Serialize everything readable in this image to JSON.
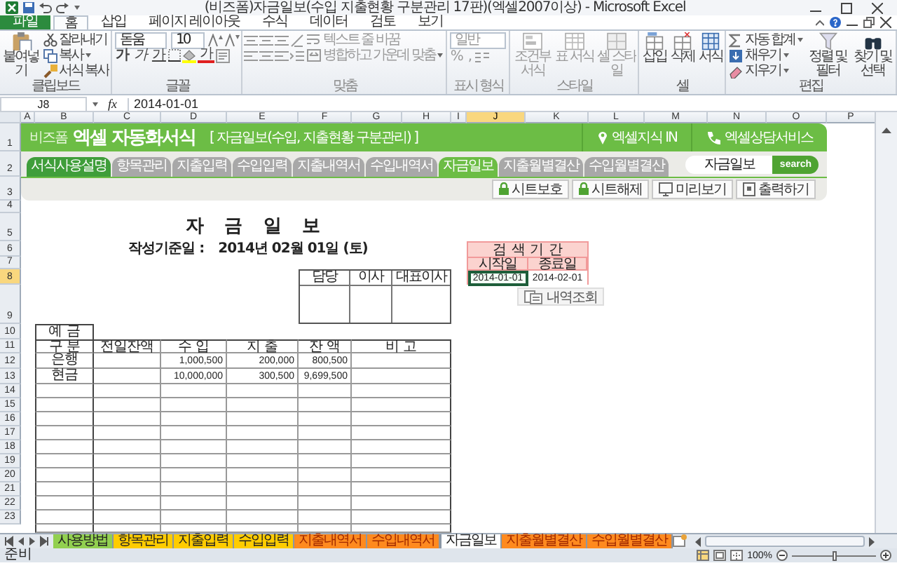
{
  "title_bar": {
    "title": "(비즈폼)자금일보(수입 지출현황 구분관리 17판)(엑셀2007이상) - Microsoft Excel"
  },
  "ribbon_tabs": [
    {
      "label": "파일",
      "kind": "file",
      "selected": false
    },
    {
      "label": "홈",
      "kind": "tab",
      "selected": true
    },
    {
      "label": "삽입",
      "kind": "tab",
      "selected": false
    },
    {
      "label": "페이지 레이아웃",
      "kind": "tab",
      "selected": false
    },
    {
      "label": "수식",
      "kind": "tab",
      "selected": false
    },
    {
      "label": "데이터",
      "kind": "tab",
      "selected": false
    },
    {
      "label": "검토",
      "kind": "tab",
      "selected": false
    },
    {
      "label": "보기",
      "kind": "tab",
      "selected": false
    }
  ],
  "ribbon_groups": [
    {
      "label": "클립보드",
      "kind": "clipboard",
      "disabled": false,
      "items": [
        "붙여넣기",
        "잘라내기",
        "복사",
        "서식 복사"
      ]
    },
    {
      "label": "글꼴",
      "kind": "font",
      "disabled": false,
      "font_name": "돋움",
      "font_size": "10",
      "items": [
        "가",
        "가",
        "가",
        "가"
      ]
    },
    {
      "label": "맞춤",
      "kind": "alignment",
      "disabled": true,
      "items": [
        "텍스트 줄 바꿈",
        "병합하고 가운데 맞춤"
      ]
    },
    {
      "label": "표시 형식",
      "kind": "number",
      "disabled": true,
      "format": "일반",
      "items": [
        "%",
        ","
      ]
    },
    {
      "label": "스타일",
      "kind": "styles",
      "disabled": true,
      "items": [
        "조건부 서식",
        "표 서식",
        "셀 스타일"
      ]
    },
    {
      "label": "셀",
      "kind": "cells",
      "disabled": false,
      "items": [
        "삽입",
        "삭제",
        "서식"
      ]
    },
    {
      "label": "편집",
      "kind": "editing",
      "disabled": false,
      "items": [
        "자동 합계",
        "채우기",
        "지우기",
        "정렬 및 필터",
        "찾기 및 선택"
      ]
    }
  ],
  "formula_bar": {
    "name_box": "J8",
    "function_label": "fx",
    "value": "2014-01-01"
  },
  "columns": [
    {
      "label": "A",
      "selected": false
    },
    {
      "label": "B",
      "selected": false
    },
    {
      "label": "C",
      "selected": false
    },
    {
      "label": "D",
      "selected": false
    },
    {
      "label": "E",
      "selected": false
    },
    {
      "label": "F",
      "selected": false
    },
    {
      "label": "G",
      "selected": false
    },
    {
      "label": "H",
      "selected": false
    },
    {
      "label": "I",
      "selected": false
    },
    {
      "label": "J",
      "selected": true
    },
    {
      "label": "K",
      "selected": false
    },
    {
      "label": "L",
      "selected": false
    },
    {
      "label": "M",
      "selected": false
    },
    {
      "label": "N",
      "selected": false
    },
    {
      "label": "O",
      "selected": false
    },
    {
      "label": "P",
      "selected": false
    }
  ],
  "rows": [
    {
      "label": "1",
      "selected": false
    },
    {
      "label": "2",
      "selected": false
    },
    {
      "label": "3",
      "selected": false
    },
    {
      "label": "4",
      "selected": false
    },
    {
      "label": "5",
      "selected": false
    },
    {
      "label": "6",
      "selected": false
    },
    {
      "label": "7",
      "selected": false
    },
    {
      "label": "8",
      "selected": true
    },
    {
      "label": "9",
      "selected": false
    },
    {
      "label": "10",
      "selected": false
    },
    {
      "label": "11",
      "selected": false
    },
    {
      "label": "12",
      "selected": false
    },
    {
      "label": "13",
      "selected": false
    },
    {
      "label": "14",
      "selected": false
    },
    {
      "label": "15",
      "selected": false
    },
    {
      "label": "16",
      "selected": false
    },
    {
      "label": "17",
      "selected": false
    },
    {
      "label": "18",
      "selected": false
    },
    {
      "label": "19",
      "selected": false
    },
    {
      "label": "20",
      "selected": false
    },
    {
      "label": "21",
      "selected": false
    },
    {
      "label": "22",
      "selected": false
    },
    {
      "label": "23",
      "selected": false
    }
  ],
  "banner": {
    "logo": "비즈폼",
    "title": "엑셀 자동화서식",
    "subtitle": "[ 자금일보(수입, 지출현황 구분관리) ]",
    "links": [
      {
        "label": "엑셀지식 IN",
        "kind": "pin"
      },
      {
        "label": "엑셀상담서비스",
        "kind": "phone"
      }
    ],
    "tabs": [
      {
        "label": "서식사용설명",
        "kind": "guide",
        "selected": false
      },
      {
        "label": "항목관리",
        "kind": "sheet",
        "selected": false
      },
      {
        "label": "지출입력",
        "kind": "sheet",
        "selected": false
      },
      {
        "label": "수입입력",
        "kind": "sheet",
        "selected": false
      },
      {
        "label": "지출내역서",
        "kind": "sheet",
        "selected": false
      },
      {
        "label": "수입내역서",
        "kind": "sheet",
        "selected": false
      },
      {
        "label": "자금일보",
        "kind": "sheet",
        "selected": true
      },
      {
        "label": "지출월별결산",
        "kind": "sheet",
        "selected": false
      },
      {
        "label": "수입월별결산",
        "kind": "sheet",
        "selected": false
      }
    ],
    "search": {
      "value": "자금일보",
      "button": "search"
    },
    "buttons": [
      {
        "label": "시트보호",
        "kind": "lock"
      },
      {
        "label": "시트해제",
        "kind": "lock"
      },
      {
        "label": "미리보기",
        "kind": "preview"
      },
      {
        "label": "출력하기",
        "kind": "print"
      }
    ]
  },
  "report": {
    "title": "자 금 일 보",
    "date_label": "작성기준일 :",
    "date": "2014년 02월 01일 (토)",
    "approval": [
      "담당",
      "이사",
      "대표이사"
    ],
    "period": {
      "title": "검 색 기 간",
      "headers": [
        "시작일",
        "종료일"
      ],
      "values": [
        {
          "text": "2014-01-01",
          "selected": true
        },
        {
          "text": "2014-02-01",
          "selected": false
        }
      ]
    },
    "lookup_button": "내역조회",
    "ledger": {
      "section": "예 금",
      "columns": [
        "구 분",
        "전일잔액",
        "수 입",
        "지 출",
        "잔 액",
        "비 고"
      ],
      "rows": [
        {
          "category": "은행",
          "income": "1,000,500",
          "expense": "200,000",
          "balance": "800,500"
        },
        {
          "category": "현금",
          "income": "10,000,000",
          "expense": "300,500",
          "balance": "9,699,500"
        }
      ]
    }
  },
  "sheet_tabs": [
    {
      "label": "사용방법",
      "color": "#92d050",
      "selected": false
    },
    {
      "label": "항목관리",
      "color": "#ffcc00",
      "selected": false
    },
    {
      "label": "지출입력",
      "color": "#ffcc00",
      "selected": false
    },
    {
      "label": "수입입력",
      "color": "#ffcc00",
      "selected": false
    },
    {
      "label": "지출내역서",
      "color": "#ff8a1f",
      "selected": false
    },
    {
      "label": "수입내역서",
      "color": "#ff8a1f",
      "selected": false
    },
    {
      "label": "자금일보",
      "selected": true
    },
    {
      "label": "지출월별결산",
      "color": "#ff8a1f",
      "selected": false
    },
    {
      "label": "수입월별결산",
      "color": "#ff8a1f",
      "selected": false
    }
  ],
  "status_bar": {
    "text": "준비",
    "zoom": "100%",
    "zoom_slider": {
      "level": 0.5
    }
  }
}
